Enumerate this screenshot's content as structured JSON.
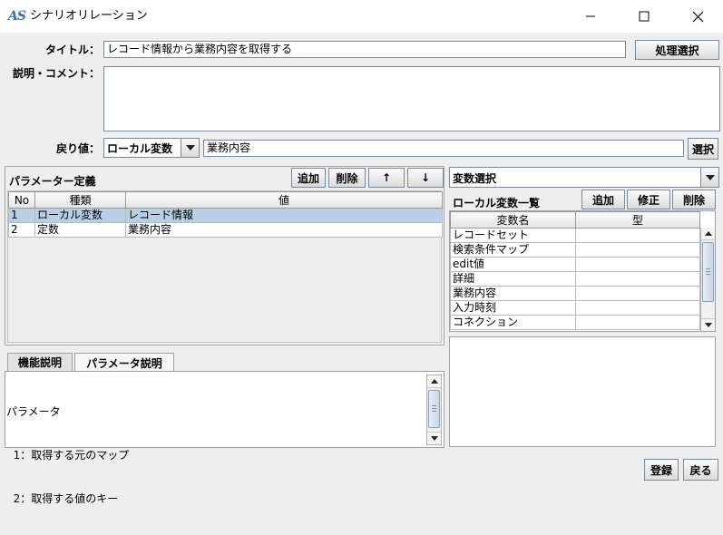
{
  "window": {
    "icon_text": "AS",
    "title": "シナリオリレーション"
  },
  "form": {
    "title_label": "タイトル：",
    "title_value": "レコード情報から業務内容を取得する",
    "process_select_button": "処理選択",
    "comment_label": "説明・コメント：",
    "comment_value": "",
    "return_label": "戻り値：",
    "return_type": "ローカル変数",
    "return_value": "業務内容",
    "select_button": "選択"
  },
  "params": {
    "title": "パラメーター定義",
    "add_button": "追加",
    "delete_button": "削除",
    "up_button": "↑",
    "down_button": "↓",
    "columns": [
      "No",
      "種類",
      "値"
    ],
    "rows": [
      {
        "no": "1",
        "kind": "ローカル変数",
        "value": "レコード情報"
      },
      {
        "no": "2",
        "kind": "定数",
        "value": "業務内容"
      }
    ]
  },
  "tabs": {
    "items": [
      "機能説明",
      "パラメータ説明"
    ],
    "selected": "パラメータ説明",
    "content_lines": [
      "パラメータ",
      "  1：取得する元のマップ",
      "  2：取得する値のキー"
    ]
  },
  "variables": {
    "selector_value": "変数選択",
    "list_title": "ローカル変数一覧",
    "add_button": "追加",
    "edit_button": "修正",
    "delete_button": "削除",
    "columns": [
      "変数名",
      "型"
    ],
    "rows": [
      {
        "name": "レコードセット",
        "type": ""
      },
      {
        "name": "検索条件マップ",
        "type": ""
      },
      {
        "name": "edit値",
        "type": ""
      },
      {
        "name": "詳細",
        "type": ""
      },
      {
        "name": "業務内容",
        "type": ""
      },
      {
        "name": "入力時刻",
        "type": ""
      },
      {
        "name": "コネクション",
        "type": ""
      }
    ]
  },
  "footer": {
    "register_button": "登録",
    "back_button": "戻る"
  },
  "colors": {
    "selection": "#b8cfe5",
    "background": "#eeeeee",
    "icon": "#3a6fb5"
  }
}
